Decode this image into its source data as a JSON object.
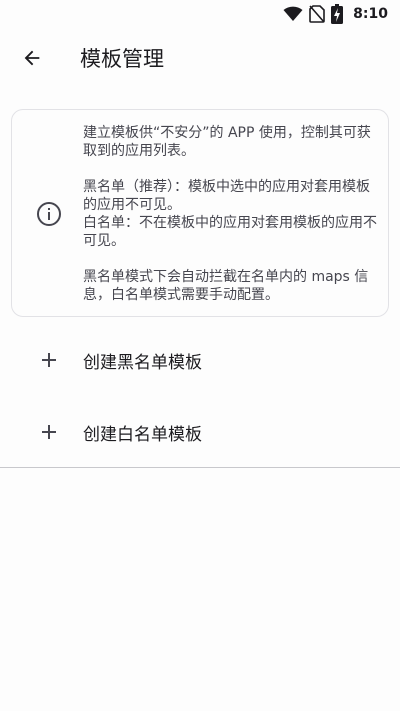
{
  "status_bar": {
    "time": "8:10",
    "icons": [
      "wifi-icon",
      "no-sim-icon",
      "battery-charging-icon"
    ]
  },
  "app_bar": {
    "back_icon": "arrow-back-icon",
    "title": "模板管理"
  },
  "info_card": {
    "icon": "info-icon",
    "paragraph_1": "建立模板供“不安分”的 APP 使用，控制其可获取到的应用列表。",
    "paragraph_2": "黑名单（推荐）：模板中选中的应用对套用模板的应用不可见。",
    "paragraph_3": "白名单：不在模板中的应用对套用模板的应用不可见。",
    "paragraph_4": "黑名单模式下会自动拦截在名单内的 maps 信息，白名单模式需要手动配置。"
  },
  "actions": [
    {
      "icon": "plus-icon",
      "label": "创建黑名单模板"
    },
    {
      "icon": "plus-icon",
      "label": "创建白名单模板"
    }
  ]
}
